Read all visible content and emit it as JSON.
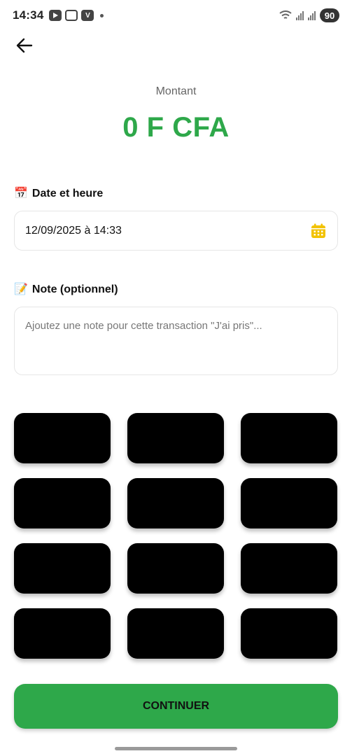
{
  "status_bar": {
    "time": "14:34",
    "battery": "90",
    "app_icon_v": "V"
  },
  "amount": {
    "label": "Montant",
    "value": "0 F CFA"
  },
  "date_section": {
    "emoji": "📅",
    "label": "Date et heure",
    "value": "12/09/2025 à 14:33"
  },
  "note_section": {
    "emoji": "📝",
    "label": "Note (optionnel)",
    "placeholder": "Ajoutez une note pour cette transaction \"J'ai pris\"..."
  },
  "continue_label": "CONTINUER",
  "colors": {
    "accent": "#2ea84a",
    "calendar_icon": "#f2c200",
    "keys": "#000000"
  },
  "icons": {
    "back": "arrow-left-icon",
    "calendar": "calendar-icon"
  }
}
